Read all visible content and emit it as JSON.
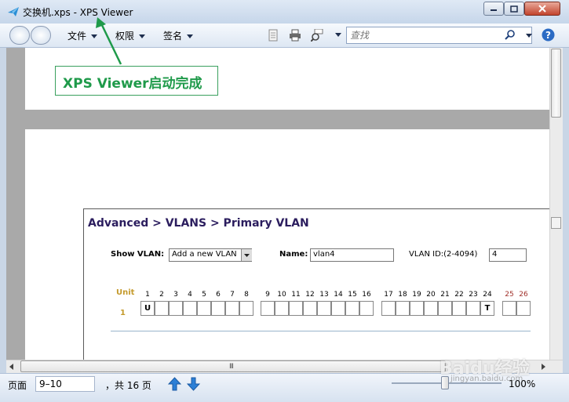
{
  "window": {
    "title": "交换机.xps - XPS Viewer"
  },
  "toolbar": {
    "menus": [
      "文件",
      "权限",
      "签名"
    ],
    "search_placeholder": "查找"
  },
  "annotation": {
    "text": "XPS Viewer启动完成"
  },
  "document": {
    "heading": "Advanced > VLANS > Primary VLAN",
    "show_vlan_label": "Show VLAN:",
    "show_vlan_value": "Add a new VLAN",
    "name_label": "Name:",
    "name_value": "vlan4",
    "vlan_id_label": "VLAN ID:(2-4094)",
    "vlan_id_value": "4",
    "unit_label": "Unit",
    "unit_value": "1",
    "ports": [
      "1",
      "2",
      "3",
      "4",
      "5",
      "6",
      "7",
      "8",
      "9",
      "10",
      "11",
      "12",
      "13",
      "14",
      "15",
      "16",
      "17",
      "18",
      "19",
      "20",
      "21",
      "22",
      "23",
      "24",
      "25",
      "26"
    ],
    "port_marks": {
      "1": "U",
      "24": "T"
    }
  },
  "statusbar": {
    "page_label": "页面",
    "page_value": "9–10",
    "total": "，共 16 页",
    "zoom": "100%",
    "zoom_fraction": 0.5
  },
  "watermark": {
    "text": "Baidu经验",
    "sub": "jingyan.baidu.com"
  },
  "colors": {
    "annotation_green": "#1f9a4a",
    "heading": "#2b1d5e",
    "unit": "#c49a2c",
    "port_red": "#a0302a"
  }
}
